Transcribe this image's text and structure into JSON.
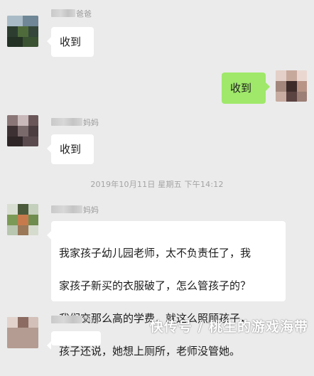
{
  "messages": [
    {
      "sender_name_suffix": "爸爸",
      "text": "收到",
      "side": "left"
    },
    {
      "text": "收到",
      "side": "right"
    },
    {
      "sender_name_suffix": "妈妈",
      "text": "收到",
      "side": "left"
    },
    {
      "sender_name_suffix": "妈妈",
      "text": "我家孩子幼儿园老师，太不负责任了，我家孩子新买的衣服破了，怎么管孩子的？我们交那么高的学费，就这么照顾孩子，孩子还说，她想上厕所，老师没管她。",
      "lines": [
        "我家孩子幼儿园老师，太不负责任了，我",
        "家孩子新买的衣服破了，怎么管孩子的？",
        "我们交那么高的学费，就这么照顾孩子，",
        "孩子还说，她想上厕所，老师没管她。"
      ],
      "side": "left"
    },
    {
      "sender_name_suffix": "妈妈",
      "side": "left"
    }
  ],
  "timestamp": "2019年10月11日 星期五 下午14:12",
  "watermark": "快传号 / 桃生的游戏海带",
  "colors": {
    "background": "#ebebeb",
    "bubble_left": "#ffffff",
    "bubble_right": "#9fe86a",
    "meta_text": "#a3a3a3"
  },
  "icons": {
    "avatars": [
      "avatar-pixelated",
      "avatar-pixelated",
      "avatar-pixelated",
      "avatar-pixelated",
      "avatar-pixelated"
    ]
  }
}
